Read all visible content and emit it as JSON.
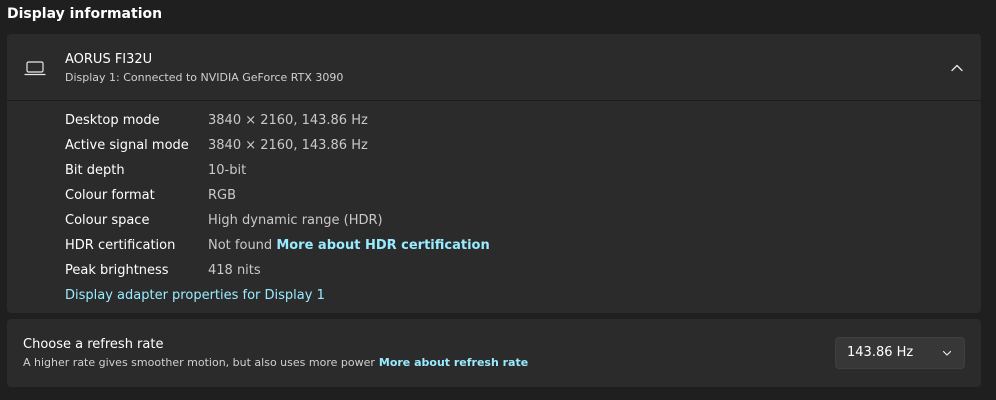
{
  "section_title": "Display information",
  "display": {
    "name": "AORUS FI32U",
    "subtitle": "Display 1: Connected to NVIDIA GeForce RTX 3090",
    "icon": "laptop-display-icon",
    "collapse_icon": "chevron-up-icon",
    "rows": [
      {
        "label": "Desktop mode",
        "value": "3840 × 2160, 143.86 Hz"
      },
      {
        "label": "Active signal mode",
        "value": "3840 × 2160, 143.86 Hz"
      },
      {
        "label": "Bit depth",
        "value": "10-bit"
      },
      {
        "label": "Colour format",
        "value": "RGB"
      },
      {
        "label": "Colour space",
        "value": "High dynamic range (HDR)"
      },
      {
        "label": "HDR certification",
        "value": "Not found",
        "link": "More about HDR certification"
      },
      {
        "label": "Peak brightness",
        "value": "418 nits"
      }
    ],
    "adapter_link": "Display adapter properties for Display 1"
  },
  "refresh": {
    "title": "Choose a refresh rate",
    "description": "A higher rate gives smoother motion, but also uses more power",
    "link": "More about refresh rate",
    "selected": "143.86 Hz",
    "chevron_icon": "chevron-down-icon"
  },
  "colors": {
    "background": "#1f1f1f",
    "card": "#2b2b2b",
    "link": "#99ebff",
    "value_text": "#c9c9c9"
  }
}
